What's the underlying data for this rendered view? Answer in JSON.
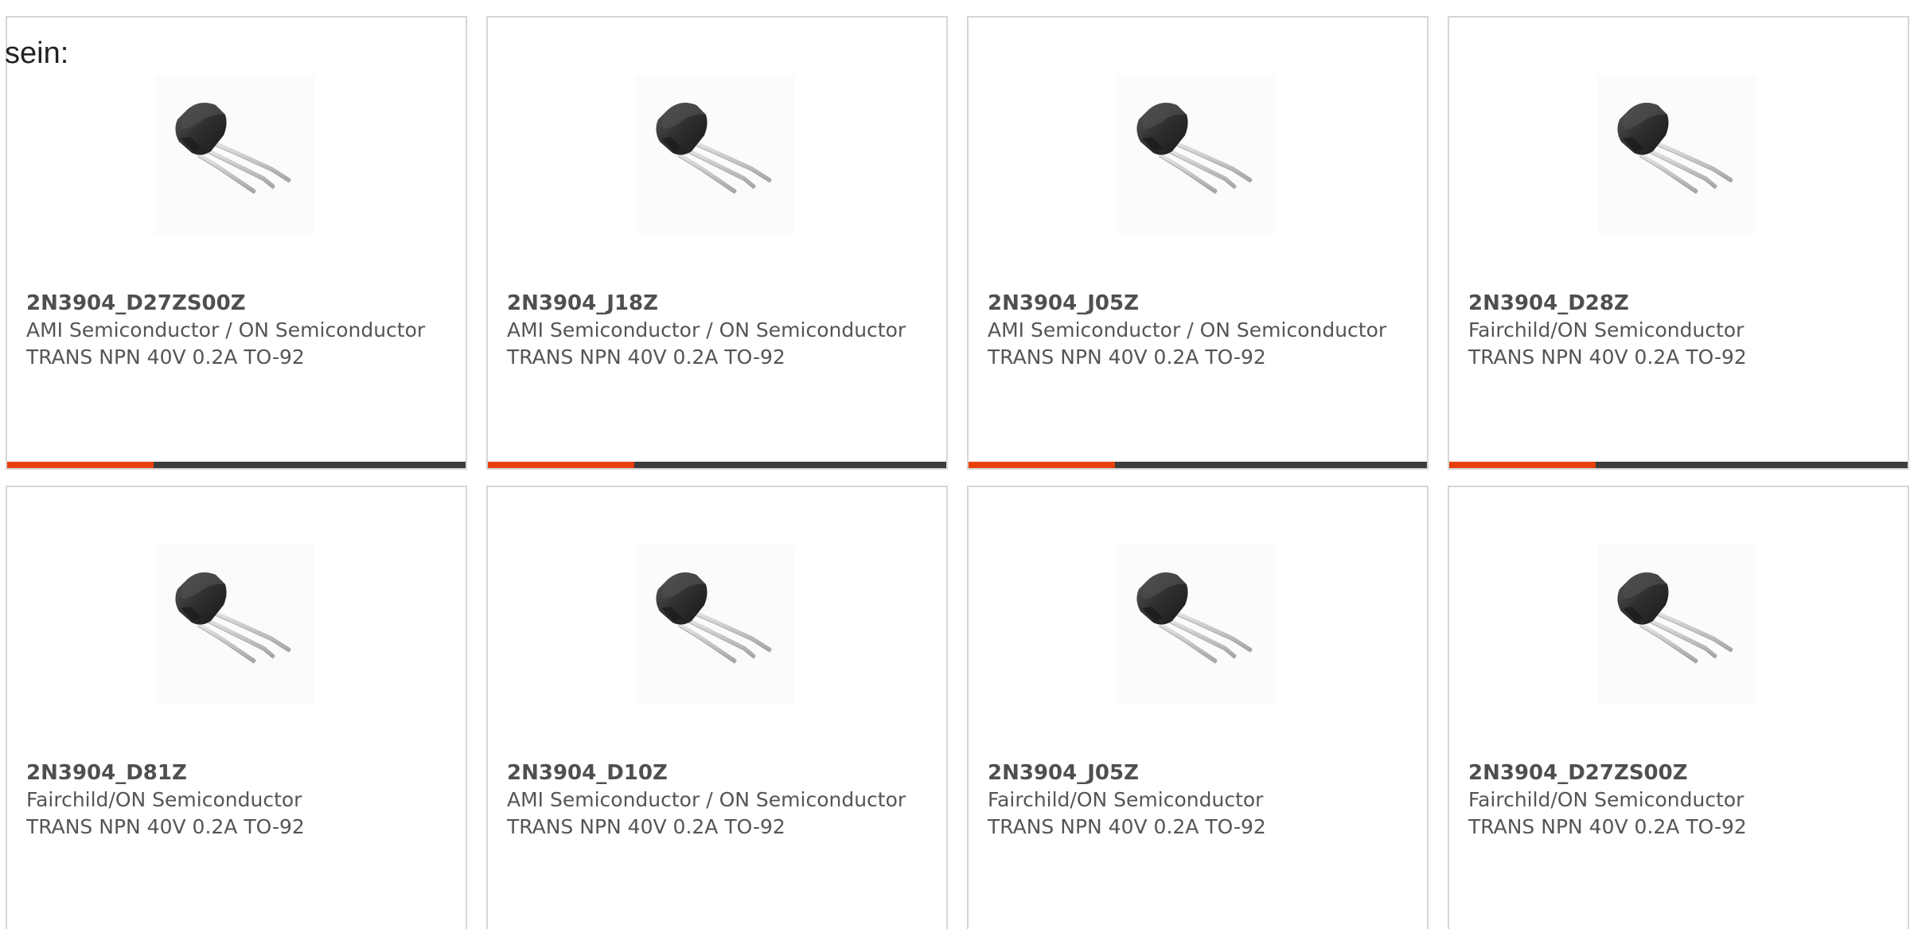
{
  "lead_text": "sein:",
  "colors": {
    "accent": "#e8400c",
    "bar": "#3c3c3c",
    "card_border": "#d6d6d6",
    "text": "#555555"
  },
  "cards": [
    {
      "part_number": "2N3904_D27ZS00Z",
      "manufacturer": "AMI Semiconductor / ON Semiconductor",
      "description": "TRANS NPN 40V 0.2A TO-92",
      "image_icon": "to92-transistor-image"
    },
    {
      "part_number": "2N3904_J18Z",
      "manufacturer": "AMI Semiconductor / ON Semiconductor",
      "description": "TRANS NPN 40V 0.2A TO-92",
      "image_icon": "to92-transistor-image"
    },
    {
      "part_number": "2N3904_J05Z",
      "manufacturer": "AMI Semiconductor / ON Semiconductor",
      "description": "TRANS NPN 40V 0.2A TO-92",
      "image_icon": "to92-transistor-image"
    },
    {
      "part_number": "2N3904_D28Z",
      "manufacturer": "Fairchild/ON Semiconductor",
      "description": "TRANS NPN 40V 0.2A TO-92",
      "image_icon": "to92-transistor-image"
    },
    {
      "part_number": "2N3904_D81Z",
      "manufacturer": "Fairchild/ON Semiconductor",
      "description": "TRANS NPN 40V 0.2A TO-92",
      "image_icon": "to92-transistor-image"
    },
    {
      "part_number": "2N3904_D10Z",
      "manufacturer": "AMI Semiconductor / ON Semiconductor",
      "description": "TRANS NPN 40V 0.2A TO-92",
      "image_icon": "to92-transistor-image"
    },
    {
      "part_number": "2N3904_J05Z",
      "manufacturer": "Fairchild/ON Semiconductor",
      "description": "TRANS NPN 40V 0.2A TO-92",
      "image_icon": "to92-transistor-image"
    },
    {
      "part_number": "2N3904_D27ZS00Z",
      "manufacturer": "Fairchild/ON Semiconductor",
      "description": "TRANS NPN 40V 0.2A TO-92",
      "image_icon": "to92-transistor-image"
    }
  ]
}
